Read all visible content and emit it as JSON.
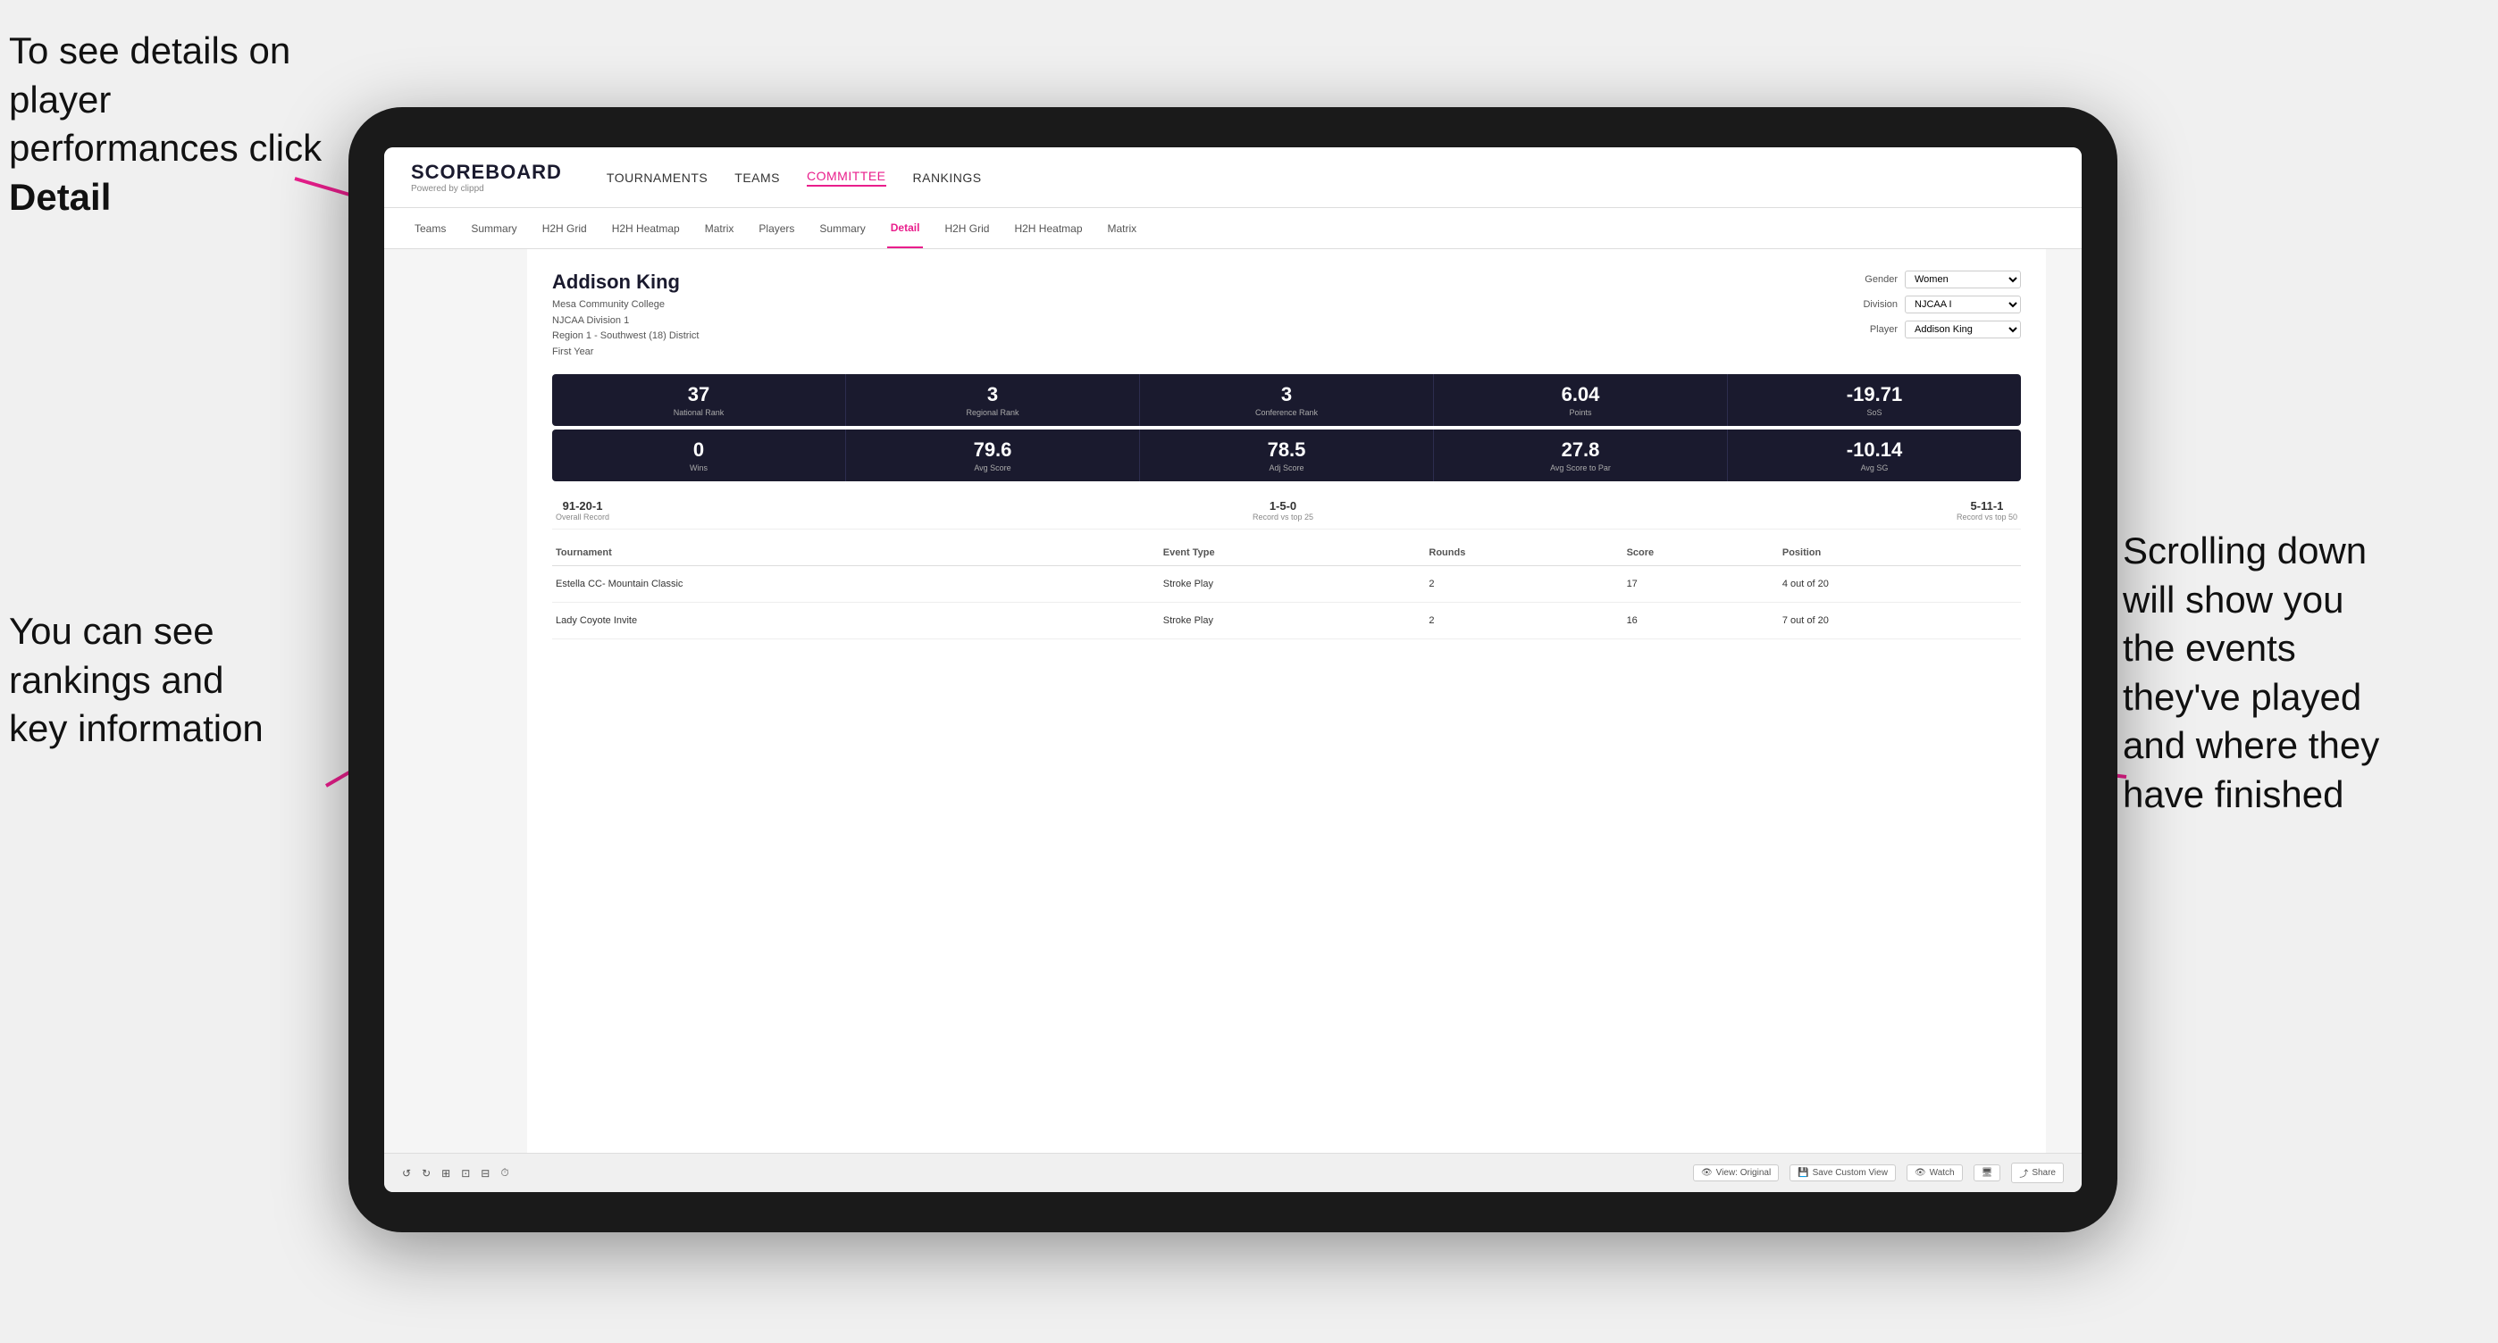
{
  "annotations": {
    "top_left": "To see details on player performances click",
    "top_left_bold": "Detail",
    "bottom_left_line1": "You can see",
    "bottom_left_line2": "rankings and",
    "bottom_left_line3": "key information",
    "right_line1": "Scrolling down",
    "right_line2": "will show you",
    "right_line3": "the events",
    "right_line4": "they've played",
    "right_line5": "and where they",
    "right_line6": "have finished"
  },
  "header": {
    "logo": "SCOREBOARD",
    "logo_sub": "Powered by clippd",
    "nav": [
      "TOURNAMENTS",
      "TEAMS",
      "COMMITTEE",
      "RANKINGS"
    ]
  },
  "sub_nav": [
    "Teams",
    "Summary",
    "H2H Grid",
    "H2H Heatmap",
    "Matrix",
    "Players",
    "Summary",
    "Detail",
    "H2H Grid",
    "H2H Heatmap",
    "Matrix"
  ],
  "player": {
    "name": "Addison King",
    "school": "Mesa Community College",
    "division": "NJCAA Division 1",
    "region": "Region 1 - Southwest (18) District",
    "year": "First Year"
  },
  "controls": {
    "gender_label": "Gender",
    "gender_value": "Women",
    "division_label": "Division",
    "division_value": "NJCAA I",
    "player_label": "Player",
    "player_value": "Addison King"
  },
  "stats_row1": [
    {
      "value": "37",
      "label": "National Rank"
    },
    {
      "value": "3",
      "label": "Regional Rank"
    },
    {
      "value": "3",
      "label": "Conference Rank"
    },
    {
      "value": "6.04",
      "label": "Points"
    },
    {
      "value": "-19.71",
      "label": "SoS"
    }
  ],
  "stats_row2": [
    {
      "value": "0",
      "label": "Wins"
    },
    {
      "value": "79.6",
      "label": "Avg Score"
    },
    {
      "value": "78.5",
      "label": "Adj Score"
    },
    {
      "value": "27.8",
      "label": "Avg Score to Par"
    },
    {
      "value": "-10.14",
      "label": "Avg SG"
    }
  ],
  "records": [
    {
      "value": "91-20-1",
      "label": "Overall Record"
    },
    {
      "value": "1-5-0",
      "label": "Record vs top 25"
    },
    {
      "value": "5-11-1",
      "label": "Record vs top 50"
    }
  ],
  "table": {
    "headers": [
      "Tournament",
      "Event Type",
      "Rounds",
      "Score",
      "Position"
    ],
    "rows": [
      {
        "tournament": "Estella CC- Mountain Classic",
        "event_type": "Stroke Play",
        "rounds": "2",
        "score": "17",
        "position": "4 out of 20"
      },
      {
        "tournament": "Lady Coyote Invite",
        "event_type": "Stroke Play",
        "rounds": "2",
        "score": "16",
        "position": "7 out of 20"
      }
    ]
  },
  "toolbar": {
    "view_label": "View: Original",
    "save_label": "Save Custom View",
    "watch_label": "Watch",
    "share_label": "Share"
  }
}
